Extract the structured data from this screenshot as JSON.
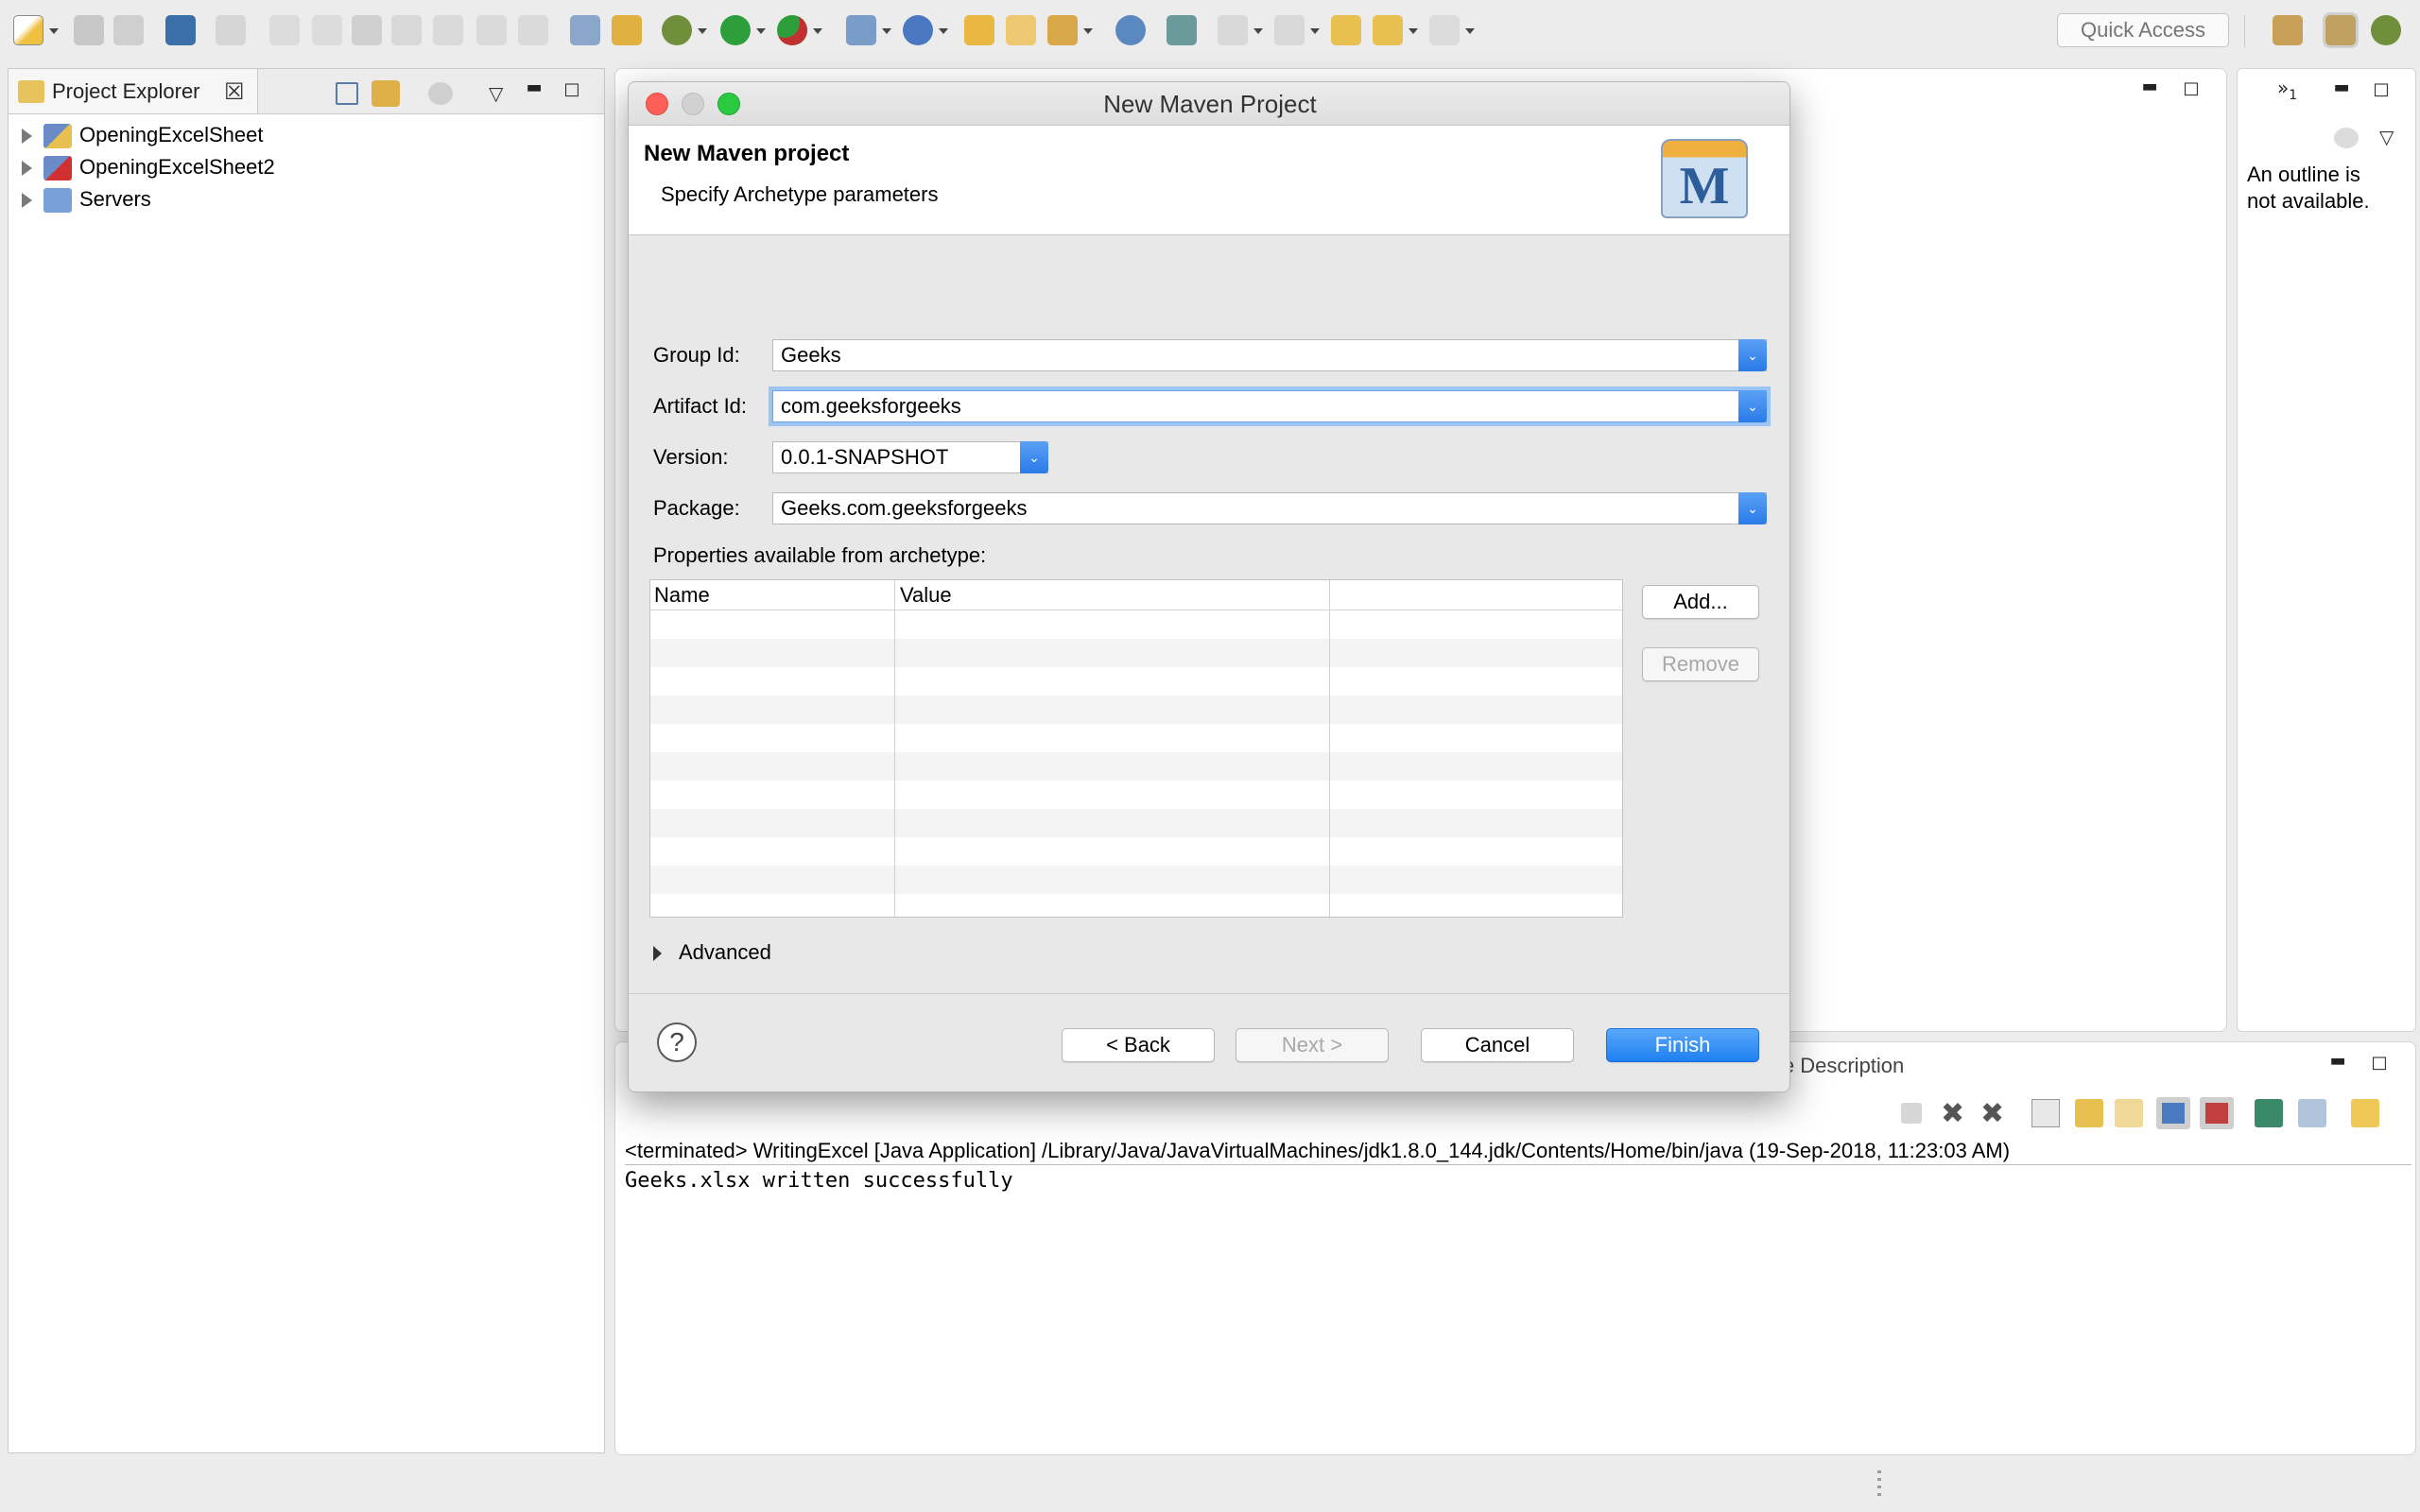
{
  "toolbar": {
    "quick_access_placeholder": "Quick Access"
  },
  "project_explorer": {
    "title": "Project Explorer",
    "items": [
      {
        "label": "OpeningExcelSheet"
      },
      {
        "label": "OpeningExcelSheet2"
      },
      {
        "label": "Servers"
      }
    ]
  },
  "outline": {
    "message_line1": "An outline is",
    "message_line2": "not available.",
    "overflow_count": "1"
  },
  "dialog": {
    "title": "New Maven Project",
    "header_title": "New Maven project",
    "header_subtitle": "Specify Archetype parameters",
    "logo_letter": "M",
    "fields": {
      "group_id_label": "Group Id:",
      "group_id_value": "Geeks",
      "artifact_id_label": "Artifact Id:",
      "artifact_id_value": "com.geeksforgeeks",
      "version_label": "Version:",
      "version_value": "0.0.1-SNAPSHOT",
      "package_label": "Package:",
      "package_value": "Geeks.com.geeksforgeeks"
    },
    "properties_label": "Properties available from archetype:",
    "table_columns": [
      "Name",
      "Value",
      ""
    ],
    "add_button": "Add...",
    "remove_button": "Remove",
    "advanced_label": "Advanced",
    "help_glyph": "?",
    "back_button": "< Back",
    "next_button": "Next >",
    "cancel_button": "Cancel",
    "finish_button": "Finish"
  },
  "bottom_panel": {
    "tab_partial": "le Description"
  },
  "console": {
    "header": "<terminated> WritingExcel [Java Application] /Library/Java/JavaVirtualMachines/jdk1.8.0_144.jdk/Contents/Home/bin/java (19-Sep-2018, 11:23:03 AM)",
    "output": "Geeks.xlsx written successfully"
  },
  "colors": {
    "accent": "#2a7ae8",
    "window_bg": "#ececec",
    "close_dot": "#fc5f57",
    "max_dot": "#2ac940"
  }
}
